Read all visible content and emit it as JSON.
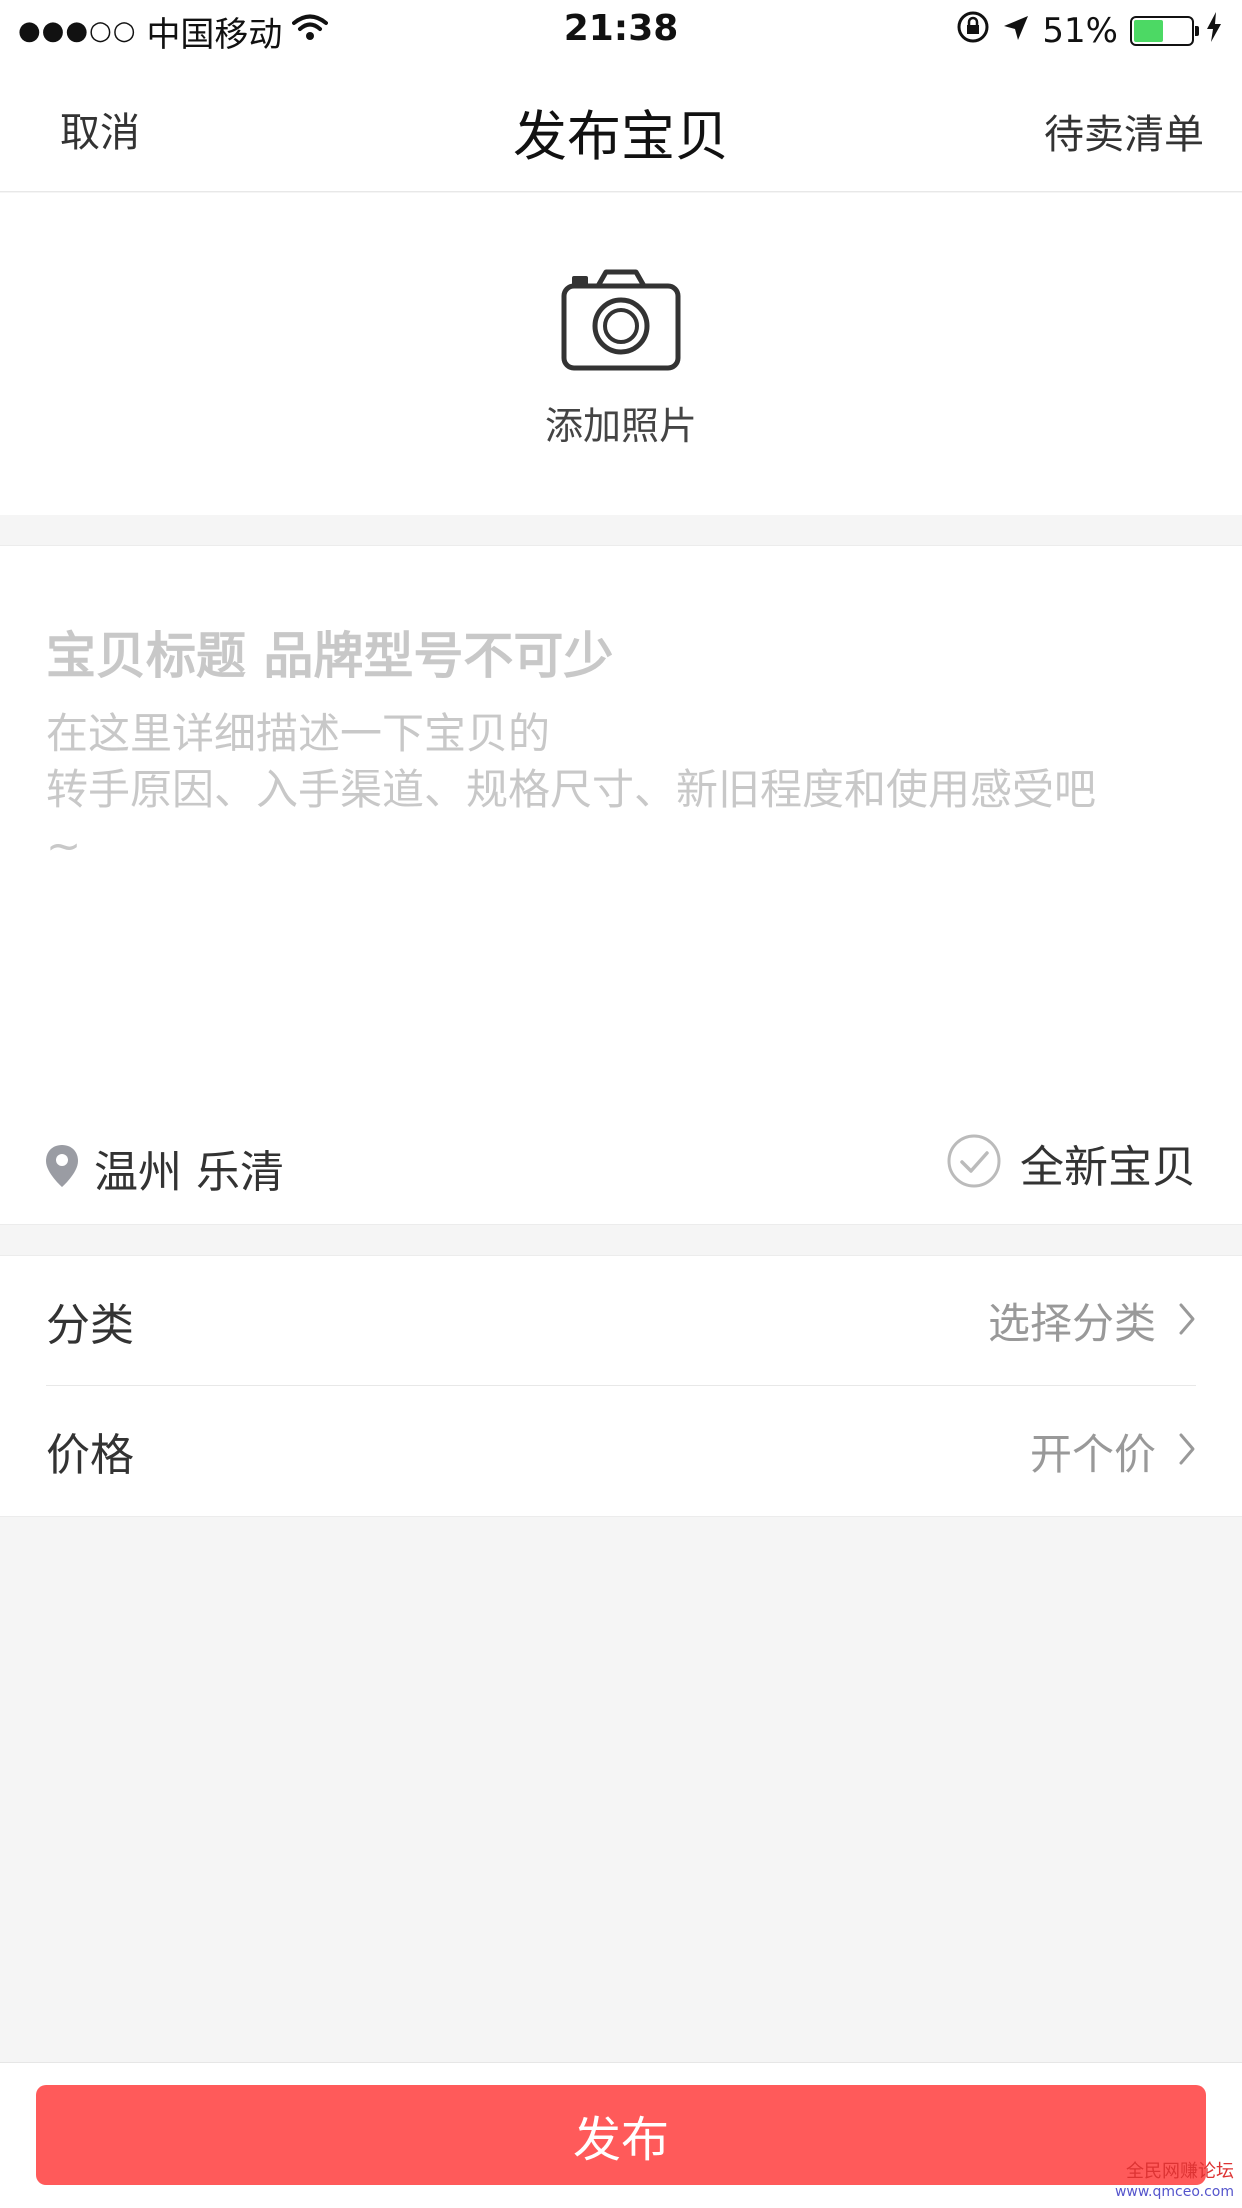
{
  "status_bar": {
    "signal": "●●●○○",
    "carrier": "中国移动",
    "time": "21:38",
    "battery_percent": "51%",
    "battery_level": 0.51,
    "icons": [
      "wifi-icon",
      "rotation-lock-icon",
      "location-arrow-icon",
      "charging-icon"
    ]
  },
  "nav": {
    "cancel": "取消",
    "title": "发布宝贝",
    "pending_list": "待卖清单"
  },
  "photo": {
    "icon": "camera-icon",
    "label": "添加照片"
  },
  "description": {
    "title_placeholder": "宝贝标题 品牌型号不可少",
    "body_placeholder": "在这里详细描述一下宝贝的\n转手原因、入手渠道、规格尺寸、新旧程度和使用感受吧\n~"
  },
  "location": {
    "icon": "location-pin-icon",
    "text": "温州 乐清"
  },
  "new_item": {
    "icon": "checkmark-circle-icon",
    "label": "全新宝贝"
  },
  "rows": [
    {
      "key": "分类",
      "value": "选择分类"
    },
    {
      "key": "价格",
      "value": "开个价"
    }
  ],
  "publish": {
    "label": "发布"
  },
  "watermark": {
    "title": "全民网赚论坛",
    "url": "www.qmceo.com"
  },
  "colors": {
    "accent": "#ff5a5a",
    "placeholder": "#c8c8c8",
    "background": "#f5f5f5"
  }
}
